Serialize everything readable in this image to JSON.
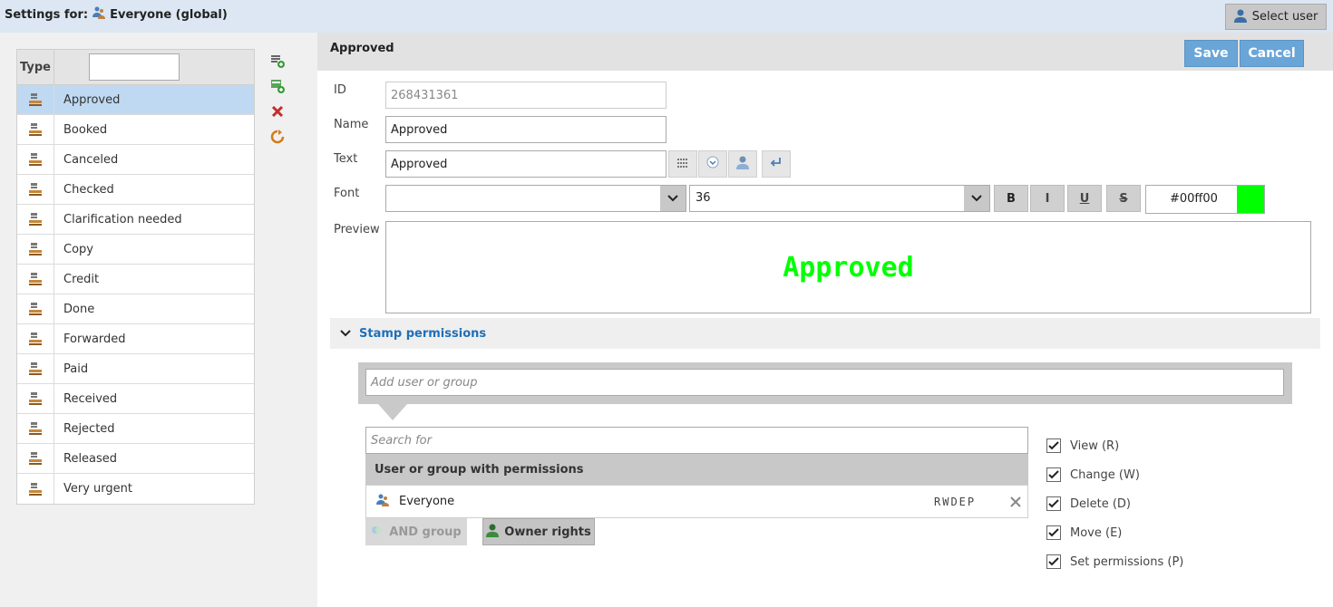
{
  "topbar": {
    "settings_for_label": "Settings for:",
    "scope_label": "Everyone (global)",
    "select_user_label": "Select user"
  },
  "type_list": {
    "column_header": "Type",
    "filter_value": "",
    "items": [
      {
        "label": "Approved",
        "selected": true
      },
      {
        "label": "Booked"
      },
      {
        "label": "Canceled"
      },
      {
        "label": "Checked"
      },
      {
        "label": "Clarification needed"
      },
      {
        "label": "Copy"
      },
      {
        "label": "Credit"
      },
      {
        "label": "Done"
      },
      {
        "label": "Forwarded"
      },
      {
        "label": "Paid"
      },
      {
        "label": "Received"
      },
      {
        "label": "Rejected"
      },
      {
        "label": "Released"
      },
      {
        "label": "Very urgent"
      }
    ]
  },
  "side_actions": [
    "add-stamp-icon",
    "add-stamp-copy-icon",
    "delete-icon",
    "refresh-icon"
  ],
  "detail": {
    "title": "Approved",
    "save_label": "Save",
    "cancel_label": "Cancel",
    "id_label": "ID",
    "id_value": "268431361",
    "name_label": "Name",
    "name_value": "Approved",
    "text_label": "Text",
    "text_value": "Approved",
    "font_label": "Font",
    "font_family_value": "",
    "font_size_value": "36",
    "bold_label": "B",
    "italic_label": "I",
    "underline_label": "U",
    "strike_label": "S",
    "color_value": "#00ff00",
    "color_text": "#00ff00",
    "preview_label": "Preview",
    "preview_text": "Approved"
  },
  "permissions": {
    "section_title": "Stamp permissions",
    "add_placeholder": "Add user or group",
    "search_placeholder": "Search for",
    "table_header": "User or group with permissions",
    "entries": [
      {
        "name": "Everyone",
        "rights": "RWDEP"
      }
    ],
    "and_group_label": "AND group",
    "owner_rights_label": "Owner rights",
    "checkboxes": [
      {
        "label": "View (R)",
        "checked": true
      },
      {
        "label": "Change (W)",
        "checked": true
      },
      {
        "label": "Delete (D)",
        "checked": true
      },
      {
        "label": "Move (E)",
        "checked": true
      },
      {
        "label": "Set permissions (P)",
        "checked": true
      }
    ]
  },
  "colors": {
    "accent": "#6aa5d8",
    "selected_row": "#bfd9f2",
    "link": "#1f6fb8",
    "preview_color": "#00ff00"
  }
}
